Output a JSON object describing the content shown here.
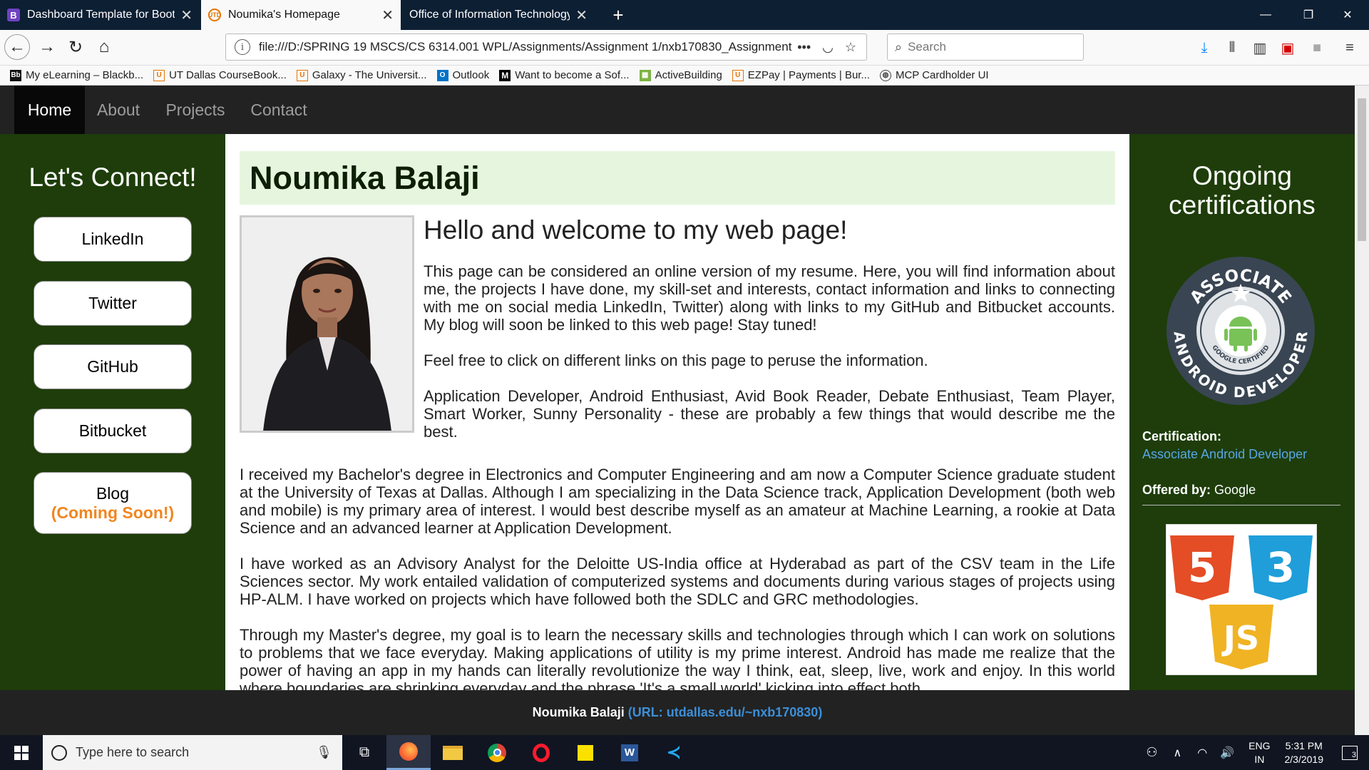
{
  "browser": {
    "tabs": [
      {
        "title": "Dashboard Template for Bootstr",
        "active": false
      },
      {
        "title": "Noumika's Homepage",
        "active": true
      },
      {
        "title": "Office of Information Technology | ",
        "active": false
      }
    ],
    "url": "file:///D:/SPRING 19 MSCS/CS 6314.001 WPL/Assignments/Assignment 1/nxb170830_Assignment",
    "url_more": "•••",
    "search_placeholder": "Search",
    "bookmarks": [
      {
        "icon": "Bb",
        "label": "My eLearning – Blackb..."
      },
      {
        "icon": "UTD",
        "label": "UT Dallas CourseBook..."
      },
      {
        "icon": "UTD",
        "label": "Galaxy - The Universit..."
      },
      {
        "icon": "O",
        "label": "Outlook"
      },
      {
        "icon": "M",
        "label": "Want to become a Sof..."
      },
      {
        "icon": "AB",
        "label": "ActiveBuilding"
      },
      {
        "icon": "UTD",
        "label": "EZPay | Payments | Bur..."
      },
      {
        "icon": "globe",
        "label": "MCP Cardholder UI"
      }
    ]
  },
  "site": {
    "nav": [
      {
        "label": "Home",
        "active": true
      },
      {
        "label": "About",
        "active": false
      },
      {
        "label": "Projects",
        "active": false
      },
      {
        "label": "Contact",
        "active": false
      }
    ],
    "left": {
      "heading": "Let's Connect!",
      "buttons": [
        "LinkedIn",
        "Twitter",
        "GitHub",
        "Bitbucket"
      ],
      "blog_label": "Blog",
      "blog_soon": "(Coming Soon!)"
    },
    "main": {
      "name": "Noumika Balaji",
      "welcome": "Hello and welcome to my web page!",
      "intro_p1": "This page can be considered an online version of my resume. Here, you will find information about me, the projects I have done, my skill-set and interests, contact information and links to connecting with me on social media LinkedIn, Twitter) along with links to my GitHub and Bitbucket accounts. My blog will soon be linked to this web page! Stay tuned!",
      "intro_p2": "Feel free to click on different links on this page to peruse the information.",
      "intro_p3": "Application Developer, Android Enthusiast, Avid Book Reader, Debate Enthusiast, Team Player, Smart Worker, Sunny Personality - these are probably a few things that would describe me the best.",
      "para1": "I received my Bachelor's degree in Electronics and Computer Engineering and am now a Computer Science graduate student at the University of Texas at Dallas. Although I am specializing in the Data Science track, Application Development (both web and mobile) is my primary area of interest. I would best describe myself as an amateur at Machine Learning, a rookie at Data Science and an advanced learner at Application Development.",
      "para2": "I have worked as an Advisory Analyst for the Deloitte US-India office at Hyderabad as part of the CSV team in the Life Sciences sector. My work entailed validation of computerized systems and documents during various stages of projects using HP-ALM. I have worked on projects which have followed both the SDLC and GRC methodologies.",
      "para3": "Through my Master's degree, my goal is to learn the necessary skills and technologies through which I can work on solutions to problems that we face everyday. Making applications of utility is my prime interest. Android has made me realize that the power of having an app in my hands can literally revolutionize the way I think, eat, sleep, live, work and enjoy. In this world where boundaries are shrinking everyday and the phrase 'It's a small world' kicking into effect both"
    },
    "right": {
      "heading": "Ongoing certifications",
      "badge_top": "ASSOCIATE",
      "badge_bottom": "ANDROID DEVELOPER",
      "badge_inner": "GOOGLE CERTIFIED",
      "cert_label": "Certification:",
      "cert_name": "Associate Android Developer",
      "offered_label": "Offered by:",
      "offered_value": "Google",
      "tech_5": "5",
      "tech_3": "3",
      "tech_js": "JS"
    },
    "footer": {
      "name": "Noumika Balaji",
      "url": "(URL: utdallas.edu/~nxb170830)"
    }
  },
  "taskbar": {
    "search_placeholder": "Type here to search",
    "lang1": "ENG",
    "lang2": "IN",
    "time": "5:31 PM",
    "date": "2/3/2019",
    "notifications": "3"
  },
  "colors": {
    "page_bg": "#1e3d0a",
    "name_bar": "#e6f6de",
    "blog_soon": "#f0861f",
    "link": "#58a6e6"
  }
}
